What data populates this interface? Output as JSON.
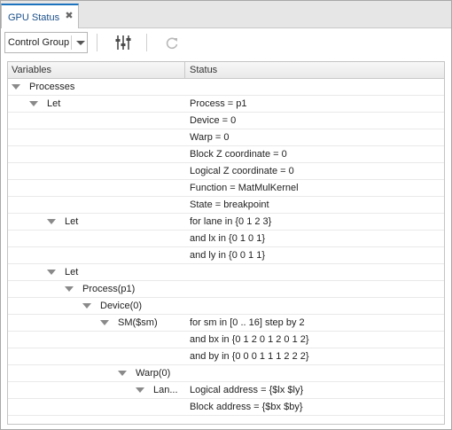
{
  "tab": {
    "title": "GPU Status",
    "close_glyph": "✖"
  },
  "toolbar": {
    "group_select": {
      "value": "Control Group"
    },
    "icons": {
      "columns": "sliders-icon",
      "refresh": "refresh-icon"
    }
  },
  "table": {
    "columns": [
      "Variables",
      "Status"
    ],
    "rows": [
      {
        "label": "Processes",
        "status": "",
        "expanded": true
      },
      {
        "label": "Let",
        "status": "Process = p1",
        "expanded": true
      },
      {
        "label": "",
        "status": "Device = 0"
      },
      {
        "label": "",
        "status": "Warp = 0"
      },
      {
        "label": "",
        "status": "Block Z coordinate = 0"
      },
      {
        "label": "",
        "status": "Logical Z coordinate = 0"
      },
      {
        "label": "",
        "status": "Function = MatMulKernel"
      },
      {
        "label": "",
        "status": "State = breakpoint"
      },
      {
        "label": "Let",
        "status": "for lane in {0 1 2 3}",
        "expanded": true
      },
      {
        "label": "",
        "status": "and lx in {0 1 0 1}"
      },
      {
        "label": "",
        "status": "and ly in {0 0 1 1}"
      },
      {
        "label": "Let",
        "status": "",
        "expanded": true
      },
      {
        "label": "Process(p1)",
        "status": "",
        "expanded": true
      },
      {
        "label": "Device(0)",
        "status": "",
        "expanded": true
      },
      {
        "label": "SM($sm)",
        "status": "for sm in [0 .. 16] step by 2",
        "expanded": true
      },
      {
        "label": "",
        "status": "and bx in {0 1 2 0 1 2 0 1 2}"
      },
      {
        "label": "",
        "status": "and by in {0 0 0 1 1 1 2 2 2}"
      },
      {
        "label": "Warp(0)",
        "status": "",
        "expanded": true
      },
      {
        "label": "Lan...",
        "status": "Logical address = {$lx $ly}",
        "expanded": true
      },
      {
        "label": "",
        "status": "Block address = {$bx $by}"
      }
    ]
  }
}
